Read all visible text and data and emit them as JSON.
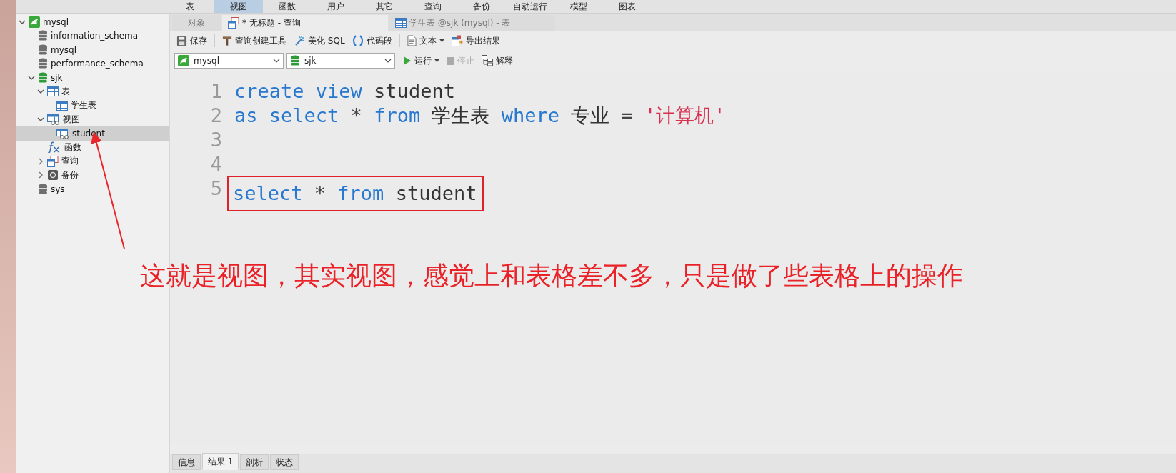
{
  "menu": [
    {
      "label": "表",
      "selected": false
    },
    {
      "label": "视图",
      "selected": true
    },
    {
      "label": "函数",
      "selected": false
    },
    {
      "label": "用户",
      "selected": false
    },
    {
      "label": "其它",
      "selected": false
    },
    {
      "label": "查询",
      "selected": false
    },
    {
      "label": "备份",
      "selected": false
    },
    {
      "label": "自动运行",
      "selected": false
    },
    {
      "label": "模型",
      "selected": false
    },
    {
      "label": "图表",
      "selected": false
    }
  ],
  "sidebar": {
    "tree": [
      {
        "label": "mysql",
        "kind": "connection",
        "expanded": true,
        "selected": false,
        "children": [
          {
            "label": "information_schema",
            "kind": "database",
            "active": false,
            "selected": false
          },
          {
            "label": "mysql",
            "kind": "database",
            "active": false,
            "selected": false
          },
          {
            "label": "performance_schema",
            "kind": "database",
            "active": false,
            "selected": false
          },
          {
            "label": "sjk",
            "kind": "database",
            "active": true,
            "expanded": true,
            "selected": false,
            "children": [
              {
                "label": "表",
                "kind": "tables",
                "expanded": true,
                "selected": false,
                "children": [
                  {
                    "label": "学生表",
                    "kind": "table",
                    "selected": false
                  }
                ]
              },
              {
                "label": "视图",
                "kind": "views",
                "expanded": true,
                "selected": false,
                "children": [
                  {
                    "label": "student",
                    "kind": "view",
                    "selected": true
                  }
                ]
              },
              {
                "label": "函数",
                "kind": "functions",
                "selected": false
              },
              {
                "label": "查询",
                "kind": "queries",
                "expanded": false,
                "selected": false
              },
              {
                "label": "备份",
                "kind": "backups",
                "expanded": false,
                "selected": false
              }
            ]
          },
          {
            "label": "sys",
            "kind": "database",
            "active": false,
            "selected": false
          }
        ]
      }
    ]
  },
  "tabs": [
    {
      "label": "对象",
      "kind": "plain",
      "selected": false
    },
    {
      "label": "* 无标题 - 查询",
      "kind": "query",
      "selected": true
    },
    {
      "label": "学生表 @sjk (mysql) - 表",
      "kind": "table",
      "selected": false
    }
  ],
  "toolbar": [
    {
      "label": "保存",
      "kind": "save",
      "dropdown": false
    },
    {
      "label": "查询创建工具",
      "kind": "builder",
      "dropdown": false
    },
    {
      "label": "美化 SQL",
      "kind": "beautify",
      "dropdown": false
    },
    {
      "label": "代码段",
      "kind": "snippet",
      "dropdown": false
    },
    {
      "label": "文本",
      "kind": "text",
      "dropdown": true
    },
    {
      "label": "导出结果",
      "kind": "export",
      "dropdown": false
    }
  ],
  "selectors": [
    {
      "value": "mysql",
      "kind": "connection"
    },
    {
      "value": "sjk",
      "kind": "database"
    }
  ],
  "run_bar": [
    {
      "label": "运行",
      "kind": "run",
      "disabled": false,
      "dropdown": true
    },
    {
      "label": "停止",
      "kind": "stop",
      "disabled": true,
      "dropdown": false
    },
    {
      "label": "解释",
      "kind": "explain",
      "disabled": false,
      "dropdown": false
    }
  ],
  "editor": {
    "lines": [
      {
        "number": "1",
        "boxed": false,
        "tokens": [
          {
            "text": "create",
            "kind": "keyword"
          },
          {
            "text": "view",
            "kind": "keyword"
          },
          {
            "text": "student",
            "kind": "ident"
          }
        ]
      },
      {
        "number": "2",
        "boxed": false,
        "tokens": [
          {
            "text": "as",
            "kind": "keyword"
          },
          {
            "text": "select",
            "kind": "keyword"
          },
          {
            "text": "*",
            "kind": "op"
          },
          {
            "text": "from",
            "kind": "keyword"
          },
          {
            "text": "学生表",
            "kind": "ident"
          },
          {
            "text": "where",
            "kind": "keyword"
          },
          {
            "text": "专业",
            "kind": "ident"
          },
          {
            "text": "=",
            "kind": "op"
          },
          {
            "text": "'计算机'",
            "kind": "string"
          }
        ]
      },
      {
        "number": "3",
        "boxed": false
      },
      {
        "number": "4",
        "boxed": false
      },
      {
        "number": "5",
        "boxed": true,
        "tokens": [
          {
            "text": "select",
            "kind": "keyword"
          },
          {
            "text": "*",
            "kind": "op"
          },
          {
            "text": "from",
            "kind": "keyword"
          },
          {
            "text": "student",
            "kind": "ident"
          }
        ]
      }
    ]
  },
  "annotation": {
    "text": "这就是视图，其实视图，感觉上和表格差不多，只是做了些表格上的操作"
  },
  "result_tabs": [
    {
      "label": "信息",
      "selected": false
    },
    {
      "label": "结果 1",
      "selected": true
    },
    {
      "label": "剖析",
      "selected": false
    },
    {
      "label": "状态",
      "selected": false
    }
  ]
}
